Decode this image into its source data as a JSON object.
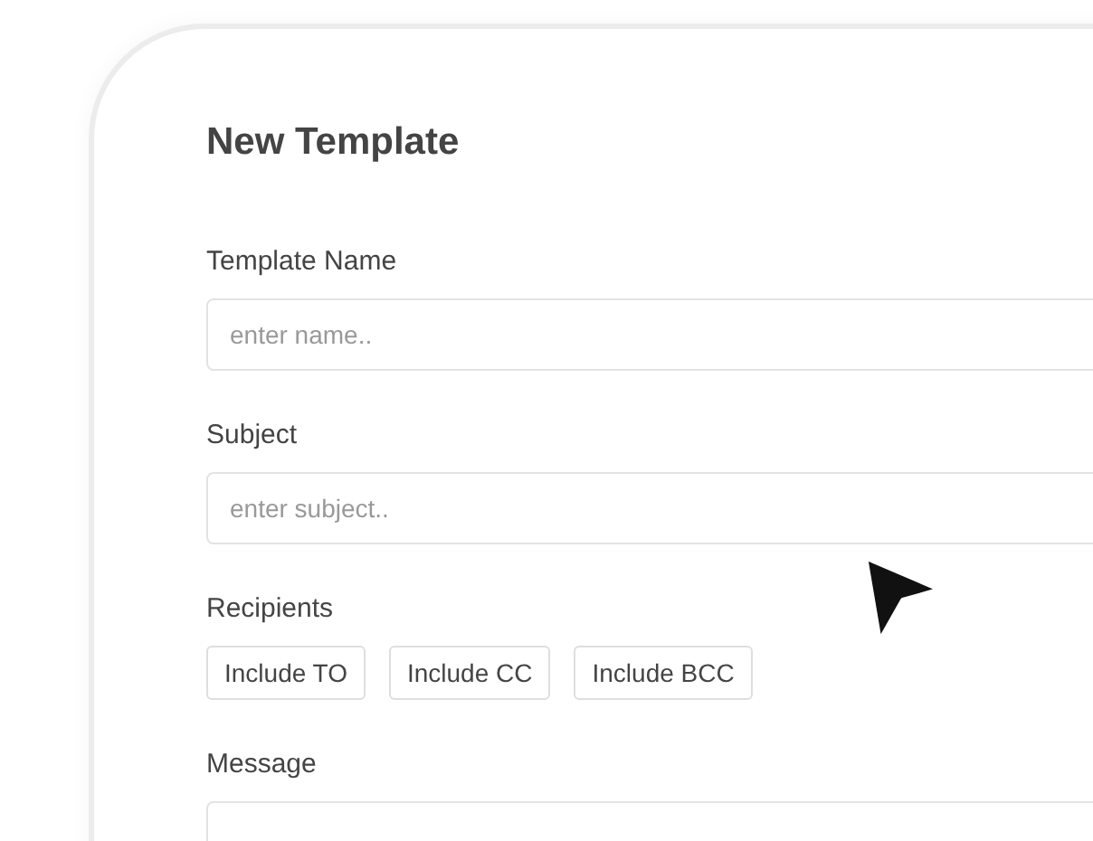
{
  "title": "New Template",
  "fields": [
    {
      "label": "Template Name",
      "kind": "input",
      "placeholder": "enter name.."
    },
    {
      "label": "Subject",
      "kind": "input",
      "placeholder": "enter subject.."
    },
    {
      "label": "Recipients",
      "kind": "buttons",
      "buttons": [
        "Include TO",
        "Include CC",
        "Include BCC"
      ]
    },
    {
      "label": "Message",
      "kind": "textarea"
    }
  ]
}
